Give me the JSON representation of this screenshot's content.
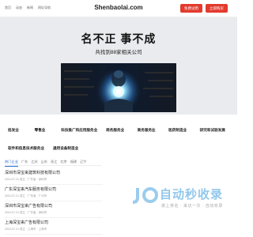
{
  "header": {
    "nav": [
      "首页",
      "动态",
      "新闻",
      "网址导航"
    ],
    "site_title": "Shenbaolai.com",
    "register_label": "免费试用",
    "login_label": "立即购买"
  },
  "hero": {
    "title": "名不正 事不成",
    "subtitle": "共找到88家相关公司"
  },
  "categories": {
    "row1": [
      "批发业",
      "零售业",
      "科技推广和应用服务业",
      "商务服务业",
      "商务服务业",
      "医药制造业",
      "研究和试验发展"
    ],
    "row2": [
      "软件和信息技术服务业",
      "通用设备制造业"
    ]
  },
  "tabs": [
    "热门企业",
    "广东",
    "江苏",
    "山东",
    "浙江",
    "北京",
    "福建",
    "辽宁"
  ],
  "list": [
    {
      "title": "深圳市深宝来建筑科技有限公司",
      "meta": "2024-07-21 成立 · 广东省 · 深圳市"
    },
    {
      "title": "广东深宝来汽车服务有限公司",
      "meta": "2024-07-21 成立 · 广东省 · 广州市"
    },
    {
      "title": "深圳市深宝来广告有限公司",
      "meta": "2024-07-21 成立 · 广东省 · 深圳市"
    },
    {
      "title": "上海深宝来广告有限公司",
      "meta": "2024-07-21 成立 · 上海市 · 上海市"
    }
  ],
  "watermark": {
    "main": "自动秒收录",
    "sub": "做上排名 · 来访一次 · 自动收录"
  },
  "colors": {
    "accent": "#e23b2e",
    "tab_active": "#2a6fd6",
    "hero_bg": "#e9ebee"
  }
}
